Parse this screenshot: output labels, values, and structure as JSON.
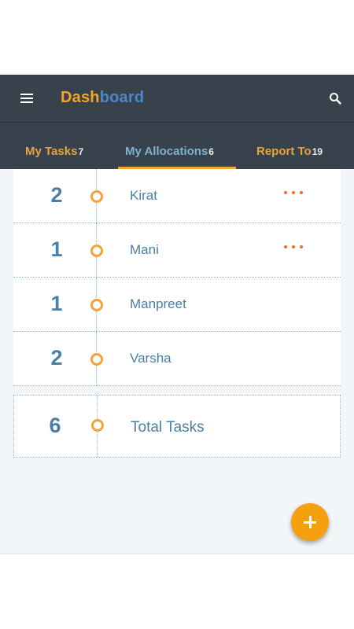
{
  "header": {
    "title_part1": "Dash",
    "title_part2": "board",
    "menu_icon": "hamburger-menu-icon",
    "search_icon": "search-icon"
  },
  "tabs": [
    {
      "label": "My Tasks",
      "count": "7",
      "active": false
    },
    {
      "label": "My Allocations",
      "count": "6",
      "active": true
    },
    {
      "label": "Report To",
      "count": "19",
      "active": false
    }
  ],
  "allocations": [
    {
      "count": "2",
      "name": "Kirat",
      "has_more": true
    },
    {
      "count": "1",
      "name": "Mani",
      "has_more": true
    },
    {
      "count": "1",
      "name": "Manpreet",
      "has_more": false
    },
    {
      "count": "2",
      "name": "Varsha",
      "has_more": false
    }
  ],
  "total": {
    "count": "6",
    "label": "Total Tasks"
  },
  "colors": {
    "appbar": "#38424c",
    "accent_orange": "#f5a623",
    "accent_blue": "#4f86c6",
    "text_blue": "#4a7fa6",
    "more_dots": "#f36a2a",
    "fab": "#f5a10f"
  },
  "fab": {
    "icon": "plus-icon"
  }
}
